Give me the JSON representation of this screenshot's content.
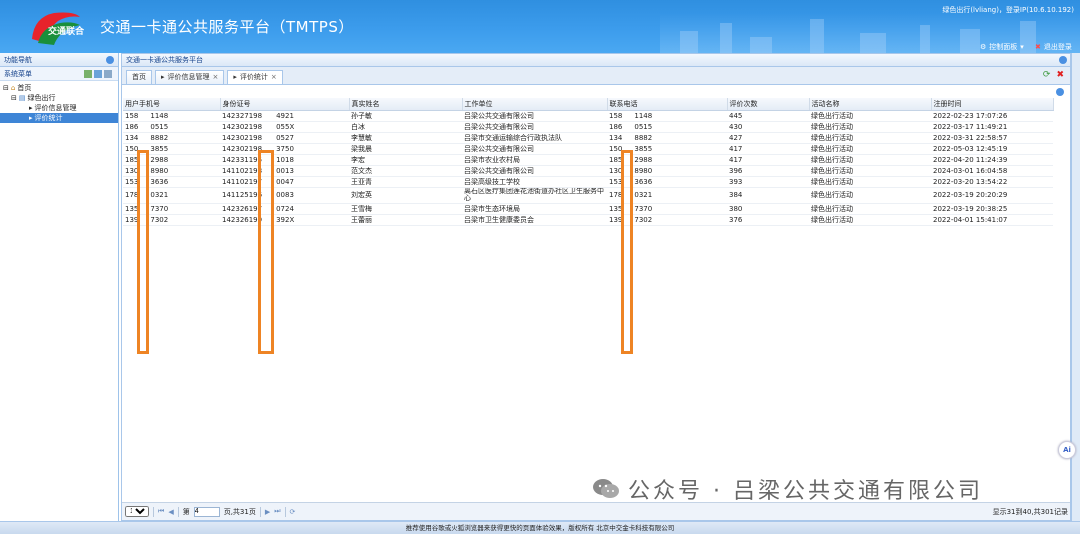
{
  "header": {
    "title": "交通一卡通公共服务平台（TMTPS）",
    "login_info": "绿色出行(lvliang)，登录IP(10.6.10.192)",
    "control_panel": "控制面板",
    "logout": "退出登录",
    "logo_text": "交通联合"
  },
  "left_panel": {
    "title": "功能导航",
    "system_menu": "系统菜单",
    "tree": {
      "home": "首页",
      "green_travel": "绿色出行",
      "rating_info_mgmt": "评价信息管理",
      "rating_stats": "评价统计"
    }
  },
  "main": {
    "title": "交通一卡通公共服务平台",
    "tabs": [
      {
        "label": "首页"
      },
      {
        "label": "评价信息管理",
        "close": "×"
      },
      {
        "label": "评价统计",
        "close": "×"
      }
    ]
  },
  "table": {
    "columns": [
      "用户手机号",
      "身份证号",
      "真实姓名",
      "工作单位",
      "联系电话",
      "评价次数",
      "活动名称",
      "注册时间"
    ],
    "rows": [
      [
        "158",
        "1148",
        "142327198",
        "4921",
        "孙子敏",
        "吕梁公共交通有限公司",
        "158",
        "1148",
        "445",
        "绿色出行活动",
        "2022-02-23 17:07:26"
      ],
      [
        "186",
        "0515",
        "142302198",
        "055X",
        "白冰",
        "吕梁公共交通有限公司",
        "186",
        "0515",
        "430",
        "绿色出行活动",
        "2022-03-17 11:49:21"
      ],
      [
        "134",
        "8882",
        "142302198",
        "0527",
        "李慧敏",
        "吕梁市交通运输综合行政执法队",
        "134",
        "8882",
        "427",
        "绿色出行活动",
        "2022-03-31 22:58:57"
      ],
      [
        "150",
        "3855",
        "142302198",
        "3750",
        "梁我晨",
        "吕梁公共交通有限公司",
        "150",
        "3855",
        "417",
        "绿色出行活动",
        "2022-05-03 12:45:19"
      ],
      [
        "185",
        "2988",
        "142331195",
        "1018",
        "李宏",
        "吕梁市农业农村局",
        "185",
        "2988",
        "417",
        "绿色出行活动",
        "2022-04-20 11:24:39"
      ],
      [
        "130",
        "8980",
        "141102198",
        "0013",
        "范文杰",
        "吕梁公共交通有限公司",
        "130",
        "8980",
        "396",
        "绿色出行活动",
        "2024-03-01 16:04:58"
      ],
      [
        "153",
        "3636",
        "141102197",
        "0047",
        "王亚青",
        "吕梁高级技工学校",
        "153",
        "3636",
        "393",
        "绿色出行活动",
        "2022-03-20 13:54:22"
      ],
      [
        "178",
        "0321",
        "141125196",
        "0083",
        "刘宏英",
        "离石区医疗集团莲花池街道办社区卫生服务中心",
        "178",
        "0321",
        "384",
        "绿色出行活动",
        "2022-03-19 20:20:29"
      ],
      [
        "135",
        "7370",
        "142326197",
        "0724",
        "王雪梅",
        "吕梁市生态环境局",
        "135",
        "7370",
        "380",
        "绿色出行活动",
        "2022-03-19 20:38:25"
      ],
      [
        "139",
        "7302",
        "142326199",
        "392X",
        "王蕾丽",
        "吕梁市卫生健康委员会",
        "139",
        "7302",
        "376",
        "绿色出行活动",
        "2022-04-01 15:41:07"
      ]
    ]
  },
  "pager": {
    "page_size": "10",
    "page_prefix": "第",
    "page_value": "4",
    "page_suffix": "页,共31页",
    "info": "显示31到40,共301记录"
  },
  "footer": {
    "text": "推荐使用谷歌或火狐浏览器来获得更快的页面体验效果，版权所有 北京中交金卡科技有限公司"
  },
  "watermark": {
    "text": "公众号 · 吕梁公共交通有限公司"
  },
  "ai_button": "Ai",
  "colors": {
    "header_blue": "#3c9cec",
    "mask_orange": "#ee8424",
    "selected_blue": "#3e85d6"
  }
}
